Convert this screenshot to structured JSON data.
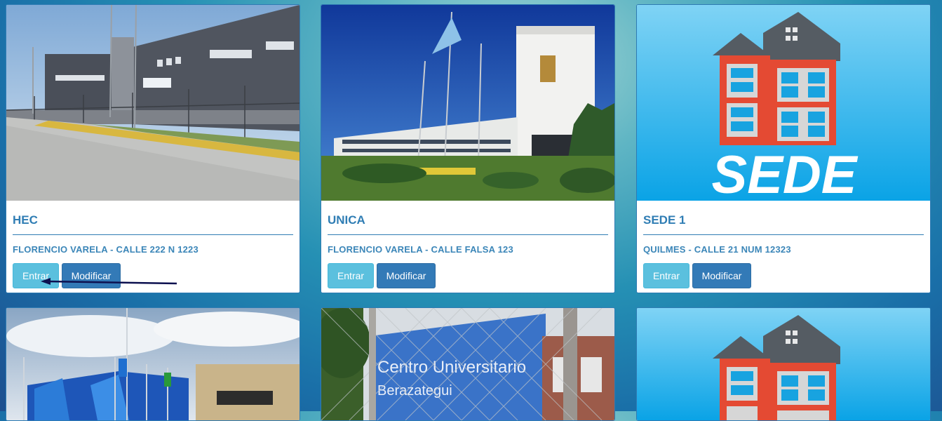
{
  "cards": [
    {
      "title": "HEC",
      "address": "FLORENCIO VARELA - CALLE 222 N 1223",
      "enter_label": "Entrar",
      "modify_label": "Modificar",
      "image": "hec-building-photo"
    },
    {
      "title": "UNICA",
      "address": "FLORENCIO VARELA - CALLE FALSA 123",
      "enter_label": "Entrar",
      "modify_label": "Modificar",
      "image": "unica-building-photo"
    },
    {
      "title": "SEDE 1",
      "address": "QUILMES - CALLE 21 NUM 12323",
      "enter_label": "Entrar",
      "modify_label": "Modificar",
      "image": "sede-logo"
    },
    {
      "image": "building-with-flags-photo"
    },
    {
      "image": "centro-universitario-berazategui-photo",
      "sign_line1": "Centro Universitario",
      "sign_line2": "Berazategui"
    },
    {
      "image": "sede-logo"
    }
  ],
  "sede_logo_text": "SEDE",
  "colors": {
    "primary": "#337ab7",
    "info": "#5bc0de",
    "title": "#2f7db4"
  }
}
